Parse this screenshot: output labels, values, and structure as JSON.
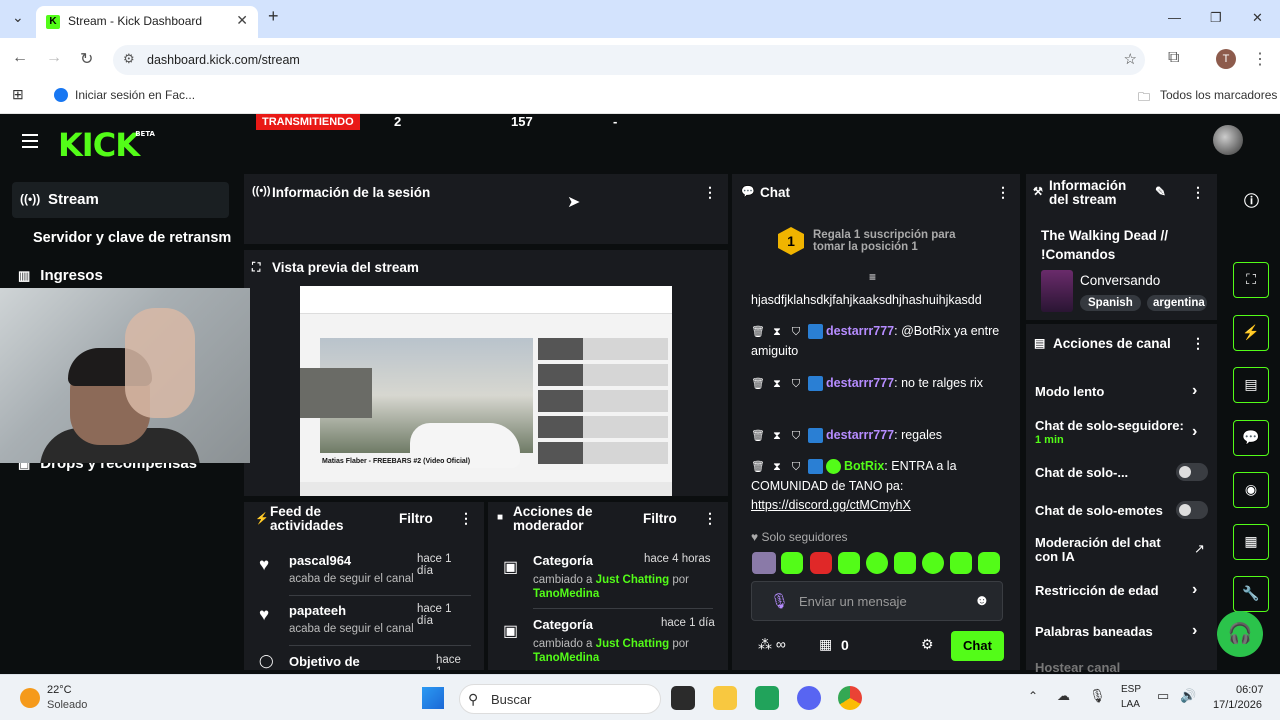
{
  "browser": {
    "tab_title": "Stream - Kick Dashboard",
    "url": "dashboard.kick.com/stream",
    "bookmark_1": "Iniciar sesión en Fac...",
    "bookmarks_all": "Todos los marcadores",
    "profile_initial": "T"
  },
  "app": {
    "logo": "KICK",
    "logo_beta": "BETA",
    "sidebar": {
      "stream": "Stream",
      "server_keys": "Servidor y clave de retransm",
      "earnings": "Ingresos",
      "drops": "Drops y recompensas"
    },
    "session": {
      "title": "Información de la sesión",
      "live_badge": "TRANSMITIENDO",
      "stat_1": "2",
      "stat_2": "157",
      "stat_3": "-"
    },
    "preview": {
      "title": "Vista previa del stream",
      "video_title": "Matias Flaber - FREEBARS #2 (Video Oficial)"
    },
    "activity": {
      "title_1": "Feed de",
      "title_2": "actividades",
      "filter": "Filtro",
      "items": [
        {
          "name": "pascal964",
          "time": "hace 1 día",
          "desc": "acaba de seguir el canal"
        },
        {
          "name": "papateeh",
          "time": "hace 1 día",
          "desc": "acaba de seguir el canal"
        },
        {
          "name": "Objetivo de",
          "time": "hace 1",
          "desc": ""
        }
      ]
    },
    "modactions": {
      "title_1": "Acciones de",
      "title_2": "moderador",
      "filter": "Filtro",
      "items": [
        {
          "title": "Categoría",
          "time": "hace 4 horas",
          "prefix": "cambiado a",
          "category": "Just Chatting",
          "by": "por",
          "user": "TanoMedina"
        },
        {
          "title": "Categoría",
          "time": "hace 1 día",
          "prefix": "cambiado a",
          "category": "Just Chatting",
          "by": "por",
          "user": "TanoMedina"
        }
      ]
    },
    "chat": {
      "title": "Chat",
      "gift_rank": "1",
      "gift_line_1": "Regala 1 suscripción para",
      "gift_line_2": "tomar la posición 1",
      "messages": [
        {
          "text": "hjasdfjklahsdkjfahjkaaksdhjhashuihjkasdd"
        },
        {
          "user": "destarrr777",
          "text": "@BotRix ya entre amiguito"
        },
        {
          "user": "destarrr777",
          "text": "no te ralges rix"
        },
        {
          "user": "destarrr777",
          "text": "regales"
        },
        {
          "user": "BotRix",
          "text": "ENTRA a la COMUNIDAD de TANO pa:",
          "link": "https://discord.gg/ctMCmyhX"
        }
      ],
      "followers_only": "Solo seguidores",
      "input_placeholder": "Enviar un mensaje",
      "points": "0",
      "send": "Chat"
    },
    "stream_info": {
      "title_1": "Información",
      "title_2": "del stream",
      "stream_title": "The Walking Dead // !Comandos",
      "category": "Conversando",
      "tag_1": "Spanish",
      "tag_2": "argentina"
    },
    "channel_actions": {
      "title": "Acciones de canal",
      "slow_mode": "Modo lento",
      "followers_chat": "Chat de solo-seguidore:",
      "followers_chat_sub": "1 min",
      "subs_chat": "Chat de solo-...",
      "emotes_chat": "Chat de solo-emotes",
      "ai_mod_1": "Moderación del chat",
      "ai_mod_2": "con IA",
      "age_restriction": "Restricción de edad",
      "banned_words": "Palabras baneadas",
      "host": "Hostear canal"
    }
  },
  "taskbar": {
    "temp": "22°C",
    "weather": "Soleado",
    "search": "Buscar",
    "lang_1": "ESP",
    "lang_2": "LAA",
    "time": "06:07",
    "date": "17/1/2026"
  }
}
